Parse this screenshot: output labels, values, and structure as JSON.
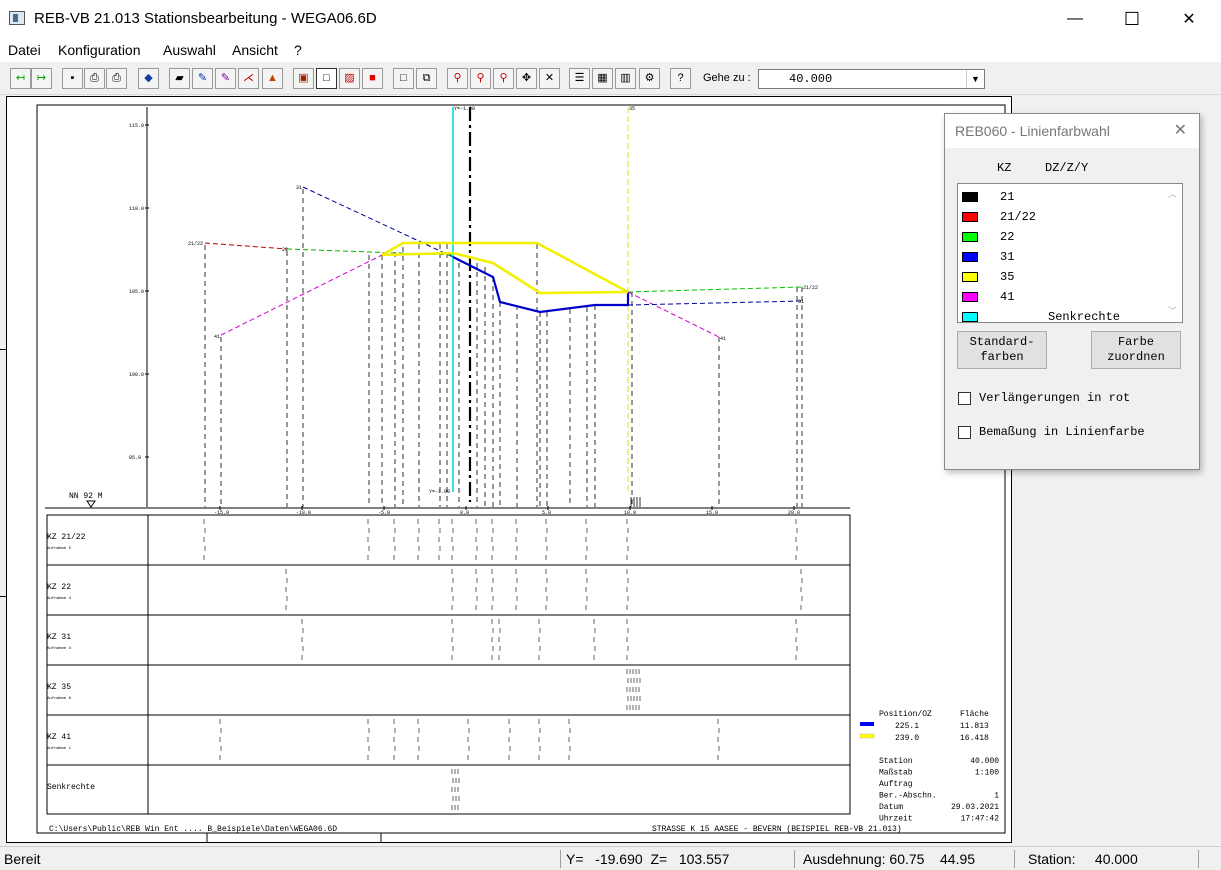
{
  "window": {
    "title": "REB-VB 21.013 Stationsbearbeitung - WEGA06.6D",
    "controls": {
      "minimize": "—",
      "maximize": "☐",
      "close": "✕"
    }
  },
  "menu": [
    "Datei",
    "Konfiguration",
    "Auswahl",
    "Ansicht",
    "?"
  ],
  "toolbar": {
    "goto_label": "Gehe zu :",
    "goto_value": "40.000",
    "buttons": [
      {
        "icon": "arrow-left-green-icon",
        "glyph": "↤",
        "color": "#00a000"
      },
      {
        "icon": "arrow-right-green-icon",
        "glyph": "↦",
        "color": "#00a000"
      },
      {
        "icon": "save-icon",
        "glyph": "▪",
        "color": "#000000"
      },
      {
        "icon": "print-icon",
        "glyph": "⎙",
        "color": "#000000"
      },
      {
        "icon": "print-preview-icon",
        "glyph": "⎙",
        "color": "#000000"
      },
      {
        "icon": "export-icon",
        "glyph": "◆",
        "color": "#1040a0"
      },
      {
        "icon": "open-folder-icon",
        "glyph": "▰",
        "color": "#000000"
      },
      {
        "icon": "pen-icon",
        "glyph": "✎",
        "color": "#0030c0"
      },
      {
        "icon": "pen-fill-icon",
        "glyph": "✎",
        "color": "#8000a0"
      },
      {
        "icon": "line-edit-icon",
        "glyph": "⋌",
        "color": "#c00000"
      },
      {
        "icon": "shape-icon",
        "glyph": "▲",
        "color": "#c04000"
      },
      {
        "icon": "layers-icon",
        "glyph": "▣",
        "color": "#a02000"
      },
      {
        "icon": "rectangle-icon",
        "glyph": "□",
        "color": "#000000"
      },
      {
        "icon": "hatch-icon",
        "glyph": "▨",
        "color": "#c00000"
      },
      {
        "icon": "fill-red-icon",
        "glyph": "■",
        "color": "#e00000"
      },
      {
        "icon": "frame-icon",
        "glyph": "□",
        "color": "#000000"
      },
      {
        "icon": "frame-arrow-icon",
        "glyph": "⧉",
        "color": "#000000"
      },
      {
        "icon": "zoom-in-icon",
        "glyph": "⚲",
        "color": "#c00000"
      },
      {
        "icon": "zoom-icon",
        "glyph": "⚲",
        "color": "#c00000"
      },
      {
        "icon": "zoom-out-icon",
        "glyph": "⚲",
        "color": "#c00000"
      },
      {
        "icon": "fit-all-icon",
        "glyph": "✥",
        "color": "#000000"
      },
      {
        "icon": "fit-window-icon",
        "glyph": "✕",
        "color": "#000000"
      },
      {
        "icon": "text-list-icon",
        "glyph": "☰",
        "color": "#000000"
      },
      {
        "icon": "table-icon",
        "glyph": "▦",
        "color": "#000000"
      },
      {
        "icon": "grid-icon",
        "glyph": "▥",
        "color": "#000000"
      },
      {
        "icon": "settings-icon",
        "glyph": "⚙",
        "color": "#000000"
      },
      {
        "icon": "help-icon",
        "glyph": "?",
        "color": "#000000"
      }
    ]
  },
  "colors": {
    "kz21": "#000000",
    "kz21_22": "#ff0000",
    "kz22": "#00ff00",
    "kz31": "#0000ff",
    "kz35": "#ffff00",
    "kz41": "#ff00ff",
    "senkrechte": "#00ffff"
  },
  "drawing": {
    "datum_label": "NN  92  M",
    "y_ticks": [
      "115.0",
      "110.0",
      "105.0",
      "100.0",
      "95.0"
    ],
    "x_ticks": [
      "-15.0",
      "-10.0",
      "-5.0",
      "0.0",
      "5.0",
      "10.0",
      "15.0",
      "20.0"
    ],
    "top_labels": [
      "Y=-1.00",
      "35"
    ],
    "bottom_label": "Y=-1.00",
    "rows": [
      {
        "kz": "KZ 21/22",
        "sub": "Aufnahme 5"
      },
      {
        "kz": "KZ 22",
        "sub": "Aufnahme 4"
      },
      {
        "kz": "KZ 31",
        "sub": "Aufnahme 4"
      },
      {
        "kz": "KZ 35",
        "sub": "Aufnahme 6"
      },
      {
        "kz": "KZ 41",
        "sub": "Aufnahme 1"
      },
      {
        "kz": "Senkrechte",
        "sub": ""
      }
    ],
    "line_labels": {
      "kz31": "31",
      "kz21_22": "21/22",
      "kz22": "22",
      "kz41_left": "41",
      "kz41_right": "41",
      "kz22_right": "21/22",
      "kz31_right": "31"
    },
    "legend": {
      "head_pos": "Position/OZ",
      "head_area": "Fläche",
      "entries": [
        {
          "pos": "225.1",
          "area": "11.813",
          "color": "#0000ff"
        },
        {
          "pos": "239.0",
          "area": "16.418",
          "color": "#ffff00"
        }
      ]
    },
    "info": [
      {
        "label": "Station",
        "value": "40.000"
      },
      {
        "label": "Maßstab",
        "value": "1:100"
      },
      {
        "label": "Auftrag",
        "value": ""
      },
      {
        "label": "Ber.-Abschn.",
        "value": "1"
      },
      {
        "label": "Datum",
        "value": "29.03.2021"
      },
      {
        "label": "Uhrzeit",
        "value": "17:47:42"
      }
    ],
    "footer_path": "C:\\Users\\Public\\REB Win Ent .... B_Beispiele\\Daten\\WEGA06.6D",
    "footer_project": "STRASSE K 15   AASEE - BEVERN (BEISPIEL REB-VB 21.013)"
  },
  "dialog": {
    "title": "REB060 - Linienfarbwahl",
    "close": "✕",
    "col_kz": "KZ",
    "col_dz": "DZ/Z/Y",
    "items": [
      {
        "label": "21",
        "color": "#000000"
      },
      {
        "label": "21/22",
        "color": "#ff0000"
      },
      {
        "label": "22",
        "color": "#00ff00"
      },
      {
        "label": "31",
        "color": "#0000ff"
      },
      {
        "label": "35",
        "color": "#ffff00"
      },
      {
        "label": "41",
        "color": "#ff00ff"
      },
      {
        "label": "Senkrechte",
        "color": "#00ffff"
      }
    ],
    "btn_standard": "Standard-\nfarben",
    "btn_farbe": "Farbe\nzuordnen",
    "chk_verl": "Verlängerungen in rot",
    "chk_bemass": "Bemaßung in Linienfarbe"
  },
  "status": {
    "ready": "Bereit",
    "coords": "Y=   -19.690  Z=   103.557",
    "extent": "Ausdehnung: 60.75    44.95",
    "station": "Station:     40.000"
  }
}
